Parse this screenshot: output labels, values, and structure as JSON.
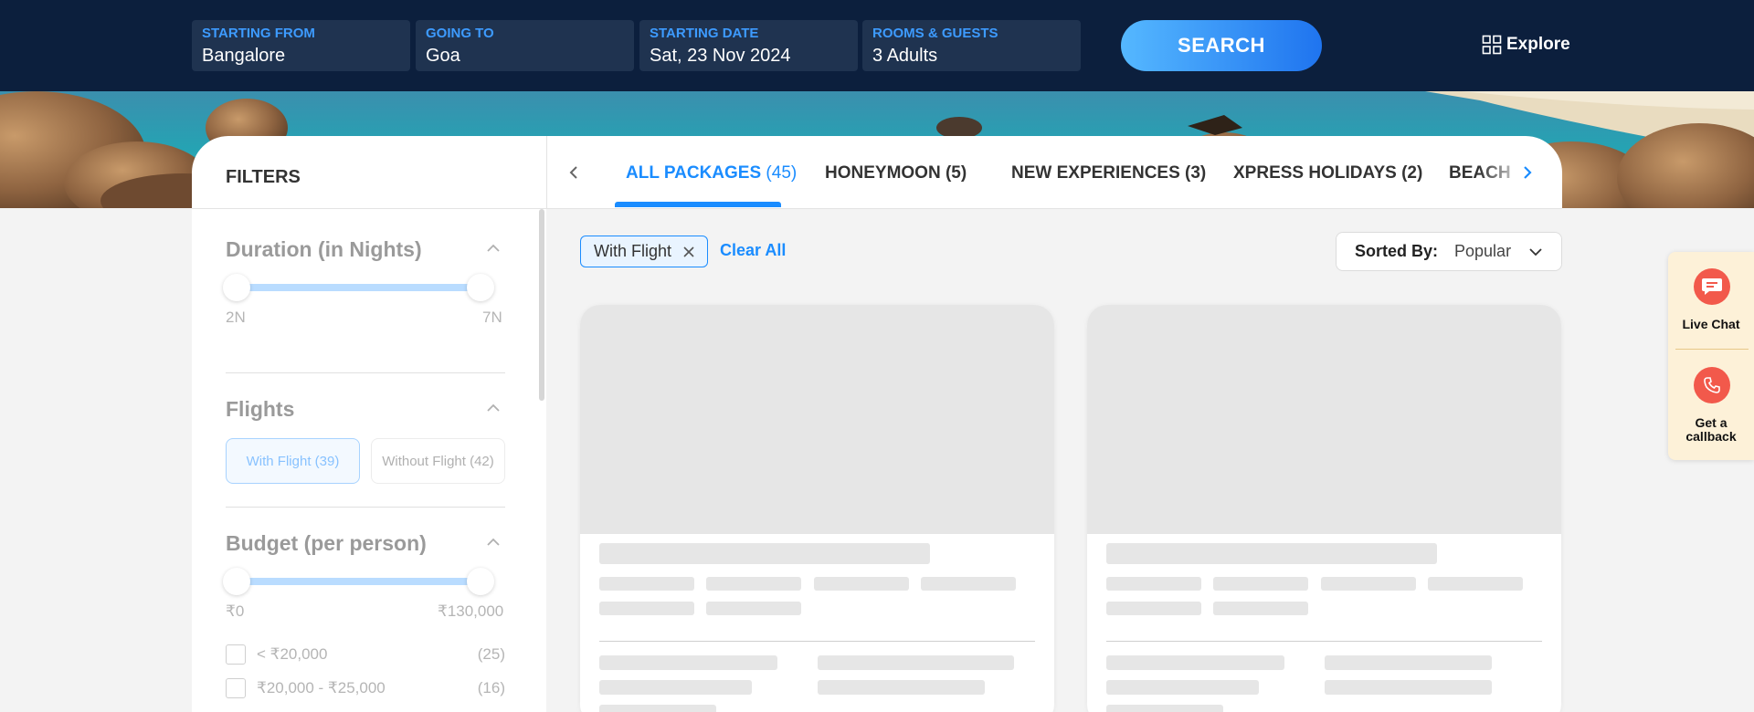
{
  "search_bar": {
    "fields": [
      {
        "label": "STARTING FROM",
        "value": "Bangalore"
      },
      {
        "label": "GOING TO",
        "value": "Goa"
      },
      {
        "label": "STARTING DATE",
        "value": "Sat, 23 Nov 2024"
      },
      {
        "label": "ROOMS & GUESTS",
        "value": "3 Adults"
      }
    ],
    "search_label": "SEARCH",
    "explore_label": "Explore"
  },
  "filters": {
    "title": "FILTERS",
    "duration": {
      "title": "Duration (in Nights)",
      "min_label": "2N",
      "max_label": "7N",
      "range_fraction": [
        0,
        1
      ]
    },
    "flights": {
      "title": "Flights",
      "with_flight": "With Flight (39)",
      "without_flight": "Without Flight (42)",
      "selected": "With Flight"
    },
    "budget": {
      "title": "Budget (per person)",
      "min_label": "₹0",
      "max_label": "₹130,000",
      "range_fraction": [
        0,
        1
      ],
      "options": [
        {
          "label": "< ₹20,000",
          "count": "(25)"
        },
        {
          "label": "₹20,000 - ₹25,000",
          "count": "(16)"
        }
      ]
    }
  },
  "tabs": [
    {
      "label": "ALL PACKAGES",
      "count": "(45)",
      "active": true
    },
    {
      "label": "HONEYMOON (5)",
      "count": "",
      "active": false
    },
    {
      "label": "NEW EXPERIENCES (3)",
      "count": "",
      "active": false
    },
    {
      "label": "XPRESS HOLIDAYS (2)",
      "count": "",
      "active": false
    },
    {
      "label": "BEACH",
      "count": "",
      "active": false
    }
  ],
  "applied_filters": {
    "chips": [
      "With Flight"
    ],
    "clear_all_label": "Clear All"
  },
  "sort": {
    "label": "Sorted By:",
    "value": "Popular"
  },
  "help_widget": {
    "live_chat": "Live Chat",
    "callback_line1": "Get a",
    "callback_line2": "callback"
  },
  "colors": {
    "topbar_bg": "#0c1f3d",
    "field_bg": "#1f3350",
    "field_label": "#3d9bff",
    "accent_blue": "#1a8cff",
    "help_bg": "#fdf1d8",
    "help_icon_red": "#f2594b"
  },
  "icons": {
    "explore": "grid-icon",
    "tab_prev": "chevron-left-icon",
    "tab_next": "chevron-right-icon",
    "section_toggle": "chevron-up-icon",
    "chip_remove": "close-icon",
    "sort": "chevron-down-icon",
    "chat": "chat-bubble-icon",
    "callback": "phone-icon"
  }
}
